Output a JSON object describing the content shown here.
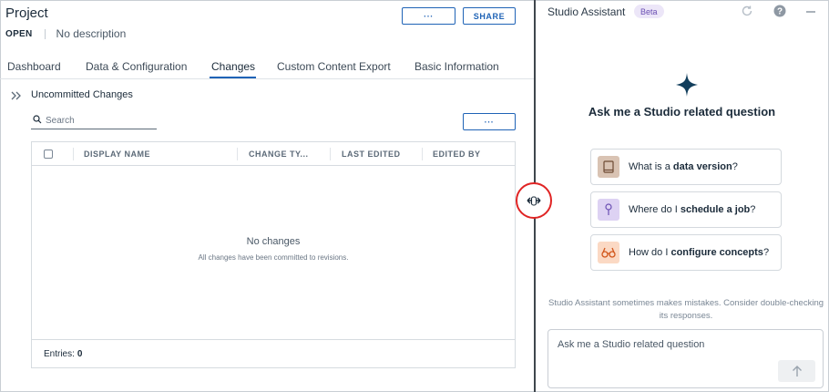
{
  "project": {
    "title": "Project",
    "status": "OPEN",
    "description": "No description",
    "more_button_label": "···",
    "share_button_label": "SHARE"
  },
  "tabs": [
    {
      "label": "Dashboard",
      "active": false
    },
    {
      "label": "Data & Configuration",
      "active": false
    },
    {
      "label": "Changes",
      "active": true
    },
    {
      "label": "Custom Content Export",
      "active": false
    },
    {
      "label": "Basic Information",
      "active": false
    }
  ],
  "changes": {
    "section_title": "Uncommitted Changes",
    "search_placeholder": "Search",
    "more_button_label": "···",
    "columns": [
      "DISPLAY NAME",
      "CHANGE TY...",
      "LAST EDITED",
      "EDITED BY"
    ],
    "rows": [],
    "empty_title": "No changes",
    "empty_subtitle": "All changes have been committed to revisions.",
    "entries_label": "Entries:",
    "entries_count": "0"
  },
  "assistant": {
    "title": "Studio Assistant",
    "badge": "Beta",
    "heading": "Ask me a Studio related question",
    "suggestions": [
      {
        "prefix": "What is a ",
        "bold": "data version",
        "suffix": "?",
        "icon": "book-icon",
        "icon_bg": "#d9c3b3",
        "icon_color": "#6d4a33"
      },
      {
        "prefix": "Where do I ",
        "bold": "schedule a job",
        "suffix": "?",
        "icon": "pin-icon",
        "icon_bg": "#ddd2f3",
        "icon_color": "#6a4fb3"
      },
      {
        "prefix": "How do I ",
        "bold": "configure concepts",
        "suffix": "?",
        "icon": "binoculars-icon",
        "icon_bg": "#fbd9c4",
        "icon_color": "#d2561b"
      }
    ],
    "disclaimer": "Studio Assistant sometimes makes mistakes. Consider double-checking its responses.",
    "input_placeholder": "Ask me a Studio related question"
  },
  "colors": {
    "accent": "#1f63b6",
    "sparkle": "#123e5c",
    "drag_highlight": "#e02424"
  }
}
